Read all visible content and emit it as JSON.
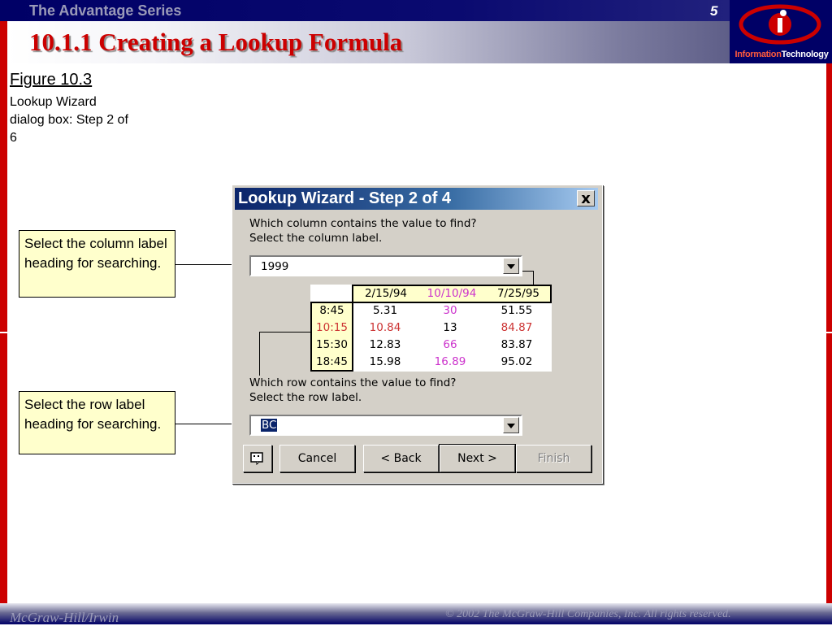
{
  "slide": {
    "series": "The Advantage Series",
    "page_number": "5",
    "title": "10.1.1 Creating a Lookup Formula",
    "logo_text_highlight": "Information",
    "logo_text_rest": "Technology",
    "publisher": "McGraw-Hill/Irwin",
    "copyright": "© 2002  The McGraw-Hill Companies, Inc. All rights reserved."
  },
  "figure": {
    "title": "Figure 10.3",
    "description": "Lookup Wizard dialog box: Step 2 of 6"
  },
  "callouts": {
    "column": "Select the column label heading for searching.",
    "row": "Select the row label heading for searching."
  },
  "dialog": {
    "title": "Lookup Wizard - Step 2 of 4",
    "close_label": "x",
    "column_question_1": "Which column contains the value to find?",
    "column_question_2": "Select the column label.",
    "column_value": "1999",
    "row_question_1": "Which row contains the value to find?",
    "row_question_2": "Select the row label.",
    "row_value": "BC",
    "buttons": {
      "cancel": "Cancel",
      "back": "< Back",
      "next": "Next >",
      "finish": "Finish"
    },
    "grid": {
      "columns": [
        "2/15/94",
        "10/10/94",
        "7/25/95"
      ],
      "rows": [
        {
          "label": "8:45",
          "values": [
            "5.31",
            "30",
            "51.55"
          ]
        },
        {
          "label": "10:15",
          "values": [
            "10.84",
            "13",
            "84.87"
          ]
        },
        {
          "label": "15:30",
          "values": [
            "12.83",
            "66",
            "83.87"
          ]
        },
        {
          "label": "18:45",
          "values": [
            "15.98",
            "16.89",
            "95.02"
          ]
        }
      ]
    }
  },
  "colors": {
    "navy": "#000066",
    "title_red": "#cc0000",
    "callout_fill": "#ffffcc",
    "dialog_gray": "#d4d0c8",
    "purple_value": "#cc33cc",
    "red_value": "#cc3333"
  }
}
